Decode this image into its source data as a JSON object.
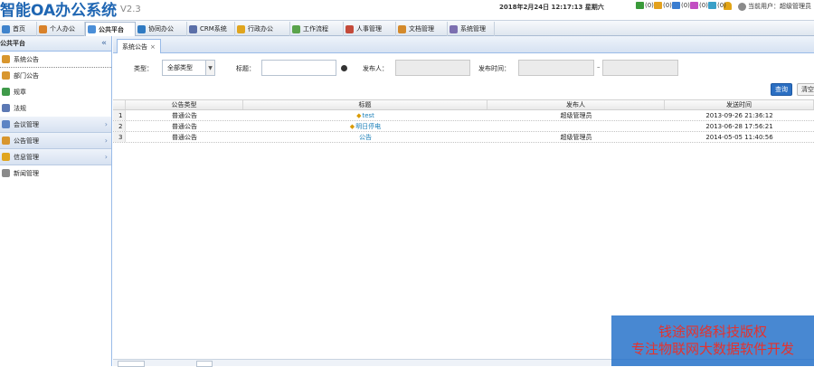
{
  "header": {
    "title": "智能OA办公系统",
    "version": "V2.3",
    "datetime": "2018年2月24日 12:17:13 星期六",
    "stats": [
      {
        "icon": "people-icon",
        "text": "(0)",
        "color": "#3a9a3a"
      },
      {
        "icon": "mail-icon",
        "text": "(0)",
        "color": "#e3a11d"
      },
      {
        "icon": "calendar-icon",
        "text": "(0)",
        "color": "#3a7dd0"
      },
      {
        "icon": "message-icon",
        "text": "(0)",
        "color": "#c24ec2"
      },
      {
        "icon": "chat-icon",
        "text": "(0)",
        "color": "#3aa0c8"
      }
    ],
    "bell_color": "#e2a415",
    "current_user": "当前用户：超级管理员"
  },
  "nav": {
    "tabs": [
      {
        "label": "首页",
        "icon": "home-icon",
        "color": "#3f83cc"
      },
      {
        "label": "个人办公",
        "icon": "person-icon",
        "color": "#d9822b"
      },
      {
        "label": "公共平台",
        "icon": "platform-icon",
        "color": "#4a8ed8"
      },
      {
        "label": "协同办公",
        "icon": "collab-icon",
        "color": "#2f7ac2"
      },
      {
        "label": "CRM系统",
        "icon": "crm-icon",
        "color": "#5b6fa8"
      },
      {
        "label": "行政办公",
        "icon": "admin-folder-icon",
        "color": "#e0a51e"
      },
      {
        "label": "工作流程",
        "icon": "workflow-icon",
        "color": "#5aa34b"
      },
      {
        "label": "人事管理",
        "icon": "hr-icon",
        "color": "#c44a3a"
      },
      {
        "label": "文档管理",
        "icon": "document-icon",
        "color": "#d48a2b"
      },
      {
        "label": "系统管理",
        "icon": "system-icon",
        "color": "#7c6fb0"
      }
    ]
  },
  "sidebar": {
    "title": "公共平台",
    "collapse": "«",
    "items": [
      {
        "label": "系统公告",
        "icon": "announce-icon",
        "color": "#d8962e"
      },
      {
        "label": "部门公告",
        "icon": "dept-announce-icon",
        "color": "#d8962e"
      },
      {
        "label": "规章",
        "icon": "rules-icon",
        "color": "#3f9a4a"
      },
      {
        "label": "法规",
        "icon": "law-icon",
        "color": "#5c79b4"
      }
    ],
    "groups": [
      {
        "label": "会议管理",
        "icon": "meeting-icon",
        "color": "#5c84c4"
      },
      {
        "label": "公告管理",
        "icon": "notice-mgmt-icon",
        "color": "#d8962e"
      },
      {
        "label": "信息管理",
        "icon": "info-mgmt-icon",
        "color": "#e0a51e"
      }
    ],
    "extra": {
      "label": "新闻管理",
      "icon": "news-icon",
      "color": "#8a8a8a"
    }
  },
  "page": {
    "tab": "系统公告",
    "tab_close": "×"
  },
  "filters": {
    "type_label": "类型：",
    "type_value": "全部类型",
    "title_label": "标题：",
    "publisher_label": "发布人：",
    "time_label": "发布时间：",
    "date_sep": "–",
    "query": "查询",
    "clear": "清空"
  },
  "table": {
    "columns": [
      "公告类型",
      "标题",
      "发布人",
      "发送时间"
    ],
    "rows": [
      {
        "num": "1",
        "type": "普通公告",
        "title": "test",
        "starred": true,
        "publisher": "超级管理员",
        "time": "2013-09-26 21:36:12"
      },
      {
        "num": "2",
        "type": "普通公告",
        "title": "明日停电",
        "starred": true,
        "publisher": "",
        "time": "2013-06-28 17:56:21"
      },
      {
        "num": "3",
        "type": "普通公告",
        "title": "公告",
        "starred": false,
        "publisher": "超级管理员",
        "time": "2014-05-05 11:40:56"
      }
    ]
  },
  "watermark": {
    "line1": "钱途网络科技版权",
    "line2": "专注物联网大数据软件开发"
  }
}
